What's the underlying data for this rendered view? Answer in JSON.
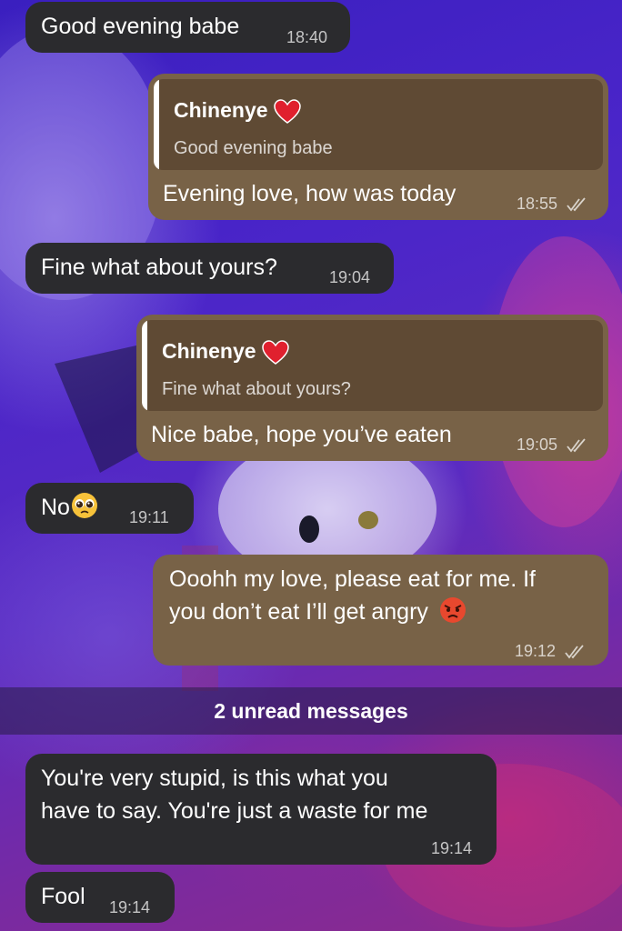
{
  "messages": [
    {
      "direction": "incoming",
      "text": "Good evening babe",
      "time": "18:40"
    },
    {
      "direction": "outgoing",
      "reply_to": {
        "name": "Chinenye",
        "text": "Good evening babe"
      },
      "text": "Evening love, how was today",
      "time": "18:55",
      "status": "read"
    },
    {
      "direction": "incoming",
      "text": "Fine what about yours?",
      "time": "19:04"
    },
    {
      "direction": "outgoing",
      "reply_to": {
        "name": "Chinenye",
        "text": "Fine what about yours?"
      },
      "text": "Nice babe, hope you’ve eaten",
      "time": "19:05",
      "status": "read"
    },
    {
      "direction": "incoming",
      "text": "No",
      "emoji": "pleading-face",
      "time": "19:11"
    },
    {
      "direction": "outgoing",
      "lines": [
        "Ooohh my love, please eat for me. If",
        "you don’t eat I’ll get angry"
      ],
      "emoji": "angry-face",
      "time": "19:12",
      "status": "read"
    },
    {
      "direction": "incoming",
      "lines": [
        "You're very stupid, is this what you",
        "have to say. You're just a waste for me"
      ],
      "time": "19:14"
    },
    {
      "direction": "incoming",
      "text": "Fool",
      "time": "19:14"
    }
  ],
  "unread_divider": "2 unread messages",
  "icons": {
    "heart": "red-heart-icon",
    "read": "double-check-icon"
  },
  "colors": {
    "incoming_bubble": "#2b2b2e",
    "outgoing_bubble": "#786247",
    "reply_quote": "#5f4a34",
    "heart": "#e0202e"
  }
}
